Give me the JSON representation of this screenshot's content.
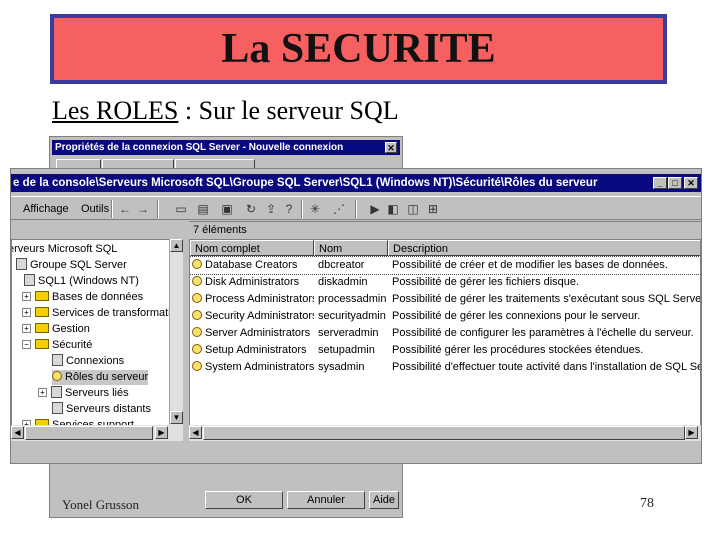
{
  "slide": {
    "title": "La SECURITE",
    "subtitle_underlined": "Les ROLES",
    "subtitle_rest": " : Sur le serveur SQL",
    "author": "Yonel Grusson",
    "page_number": "78"
  },
  "dialog": {
    "title": "Propriétés de la connexion SQL Server - Nouvelle connexion",
    "close": "✕",
    "buttons": {
      "ok": "OK",
      "cancel": "Annuler",
      "help": "Aide"
    }
  },
  "window": {
    "title": "e de la console\\Serveurs Microsoft SQL\\Groupe SQL Server\\SQL1 (Windows NT)\\Sécurité\\Rôles du serveur",
    "controls": {
      "minimize": "_",
      "maximize": "□",
      "close": "✕"
    },
    "menu": {
      "view": "Affichage",
      "tools": "Outils"
    },
    "item_count": "7 éléments"
  },
  "tree": {
    "items": [
      {
        "label": "erveurs Microsoft SQL"
      },
      {
        "label": "Groupe SQL Server"
      },
      {
        "label": "SQL1 (Windows NT)"
      },
      {
        "label": "Bases de données"
      },
      {
        "label": "Services de transformation"
      },
      {
        "label": "Gestion"
      },
      {
        "label": "Sécurité"
      },
      {
        "label": "Connexions"
      },
      {
        "label": "Rôles du serveur"
      },
      {
        "label": "Serveurs liés"
      },
      {
        "label": "Serveurs distants"
      },
      {
        "label": "Services support"
      }
    ]
  },
  "list": {
    "headers": {
      "full_name": "Nom complet",
      "name": "Nom",
      "description": "Description"
    },
    "rows": [
      {
        "full_name": "Database Creators",
        "name": "dbcreator",
        "description": "Possibilité de créer et de modifier les bases de données."
      },
      {
        "full_name": "Disk Administrators",
        "name": "diskadmin",
        "description": "Possibilité de gérer les fichiers disque."
      },
      {
        "full_name": "Process Administrators",
        "name": "processadmin",
        "description": "Possibilité de gérer les traitements s'exécutant sous SQL Server."
      },
      {
        "full_name": "Security Administrators",
        "name": "securityadmin",
        "description": "Possibilité de gérer les connexions pour le serveur."
      },
      {
        "full_name": "Server Administrators",
        "name": "serveradmin",
        "description": "Possibilité de configurer les paramètres à l'échelle du serveur."
      },
      {
        "full_name": "Setup Administrators",
        "name": "setupadmin",
        "description": "Possibilité gérer les procédures stockées étendues."
      },
      {
        "full_name": "System Administrators",
        "name": "sysadmin",
        "description": "Possibilité d'effectuer toute activité dans l'installation de SQL Server."
      }
    ]
  }
}
